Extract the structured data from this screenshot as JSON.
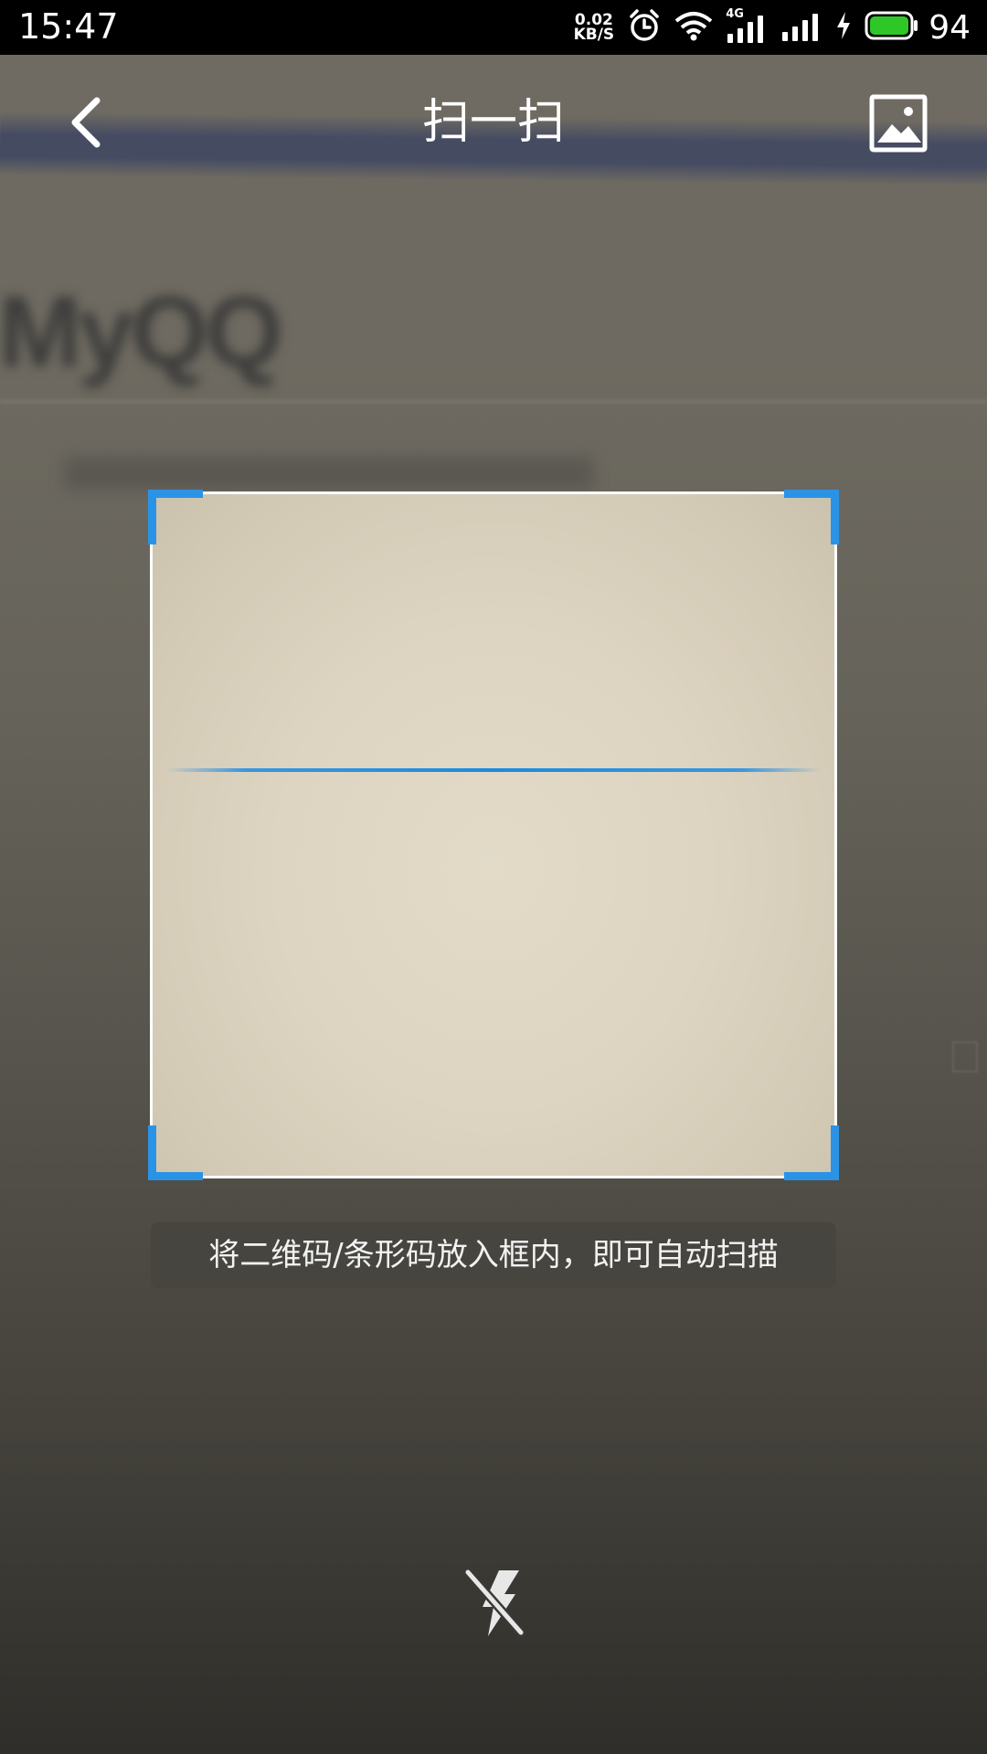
{
  "status_bar": {
    "time": "15:47",
    "net_speed_value": "0.02",
    "net_speed_unit": "KB/S",
    "network_type": "4G",
    "battery_percent": "94",
    "battery_color": "#2ec727",
    "icons": [
      "alarm-icon",
      "wifi-icon",
      "signal-4g-icon",
      "signal-icon",
      "charging-icon",
      "battery-icon"
    ]
  },
  "app_bar": {
    "title": "扫一扫",
    "back_icon": "chevron-left-icon",
    "album_icon": "image-album-icon"
  },
  "background": {
    "blurred_text": "MyQQ"
  },
  "scanner": {
    "accent_color": "#2a93e6",
    "hint": "将二维码/条形码放入框内，即可自动扫描",
    "flash_icon": "flash-off-icon"
  }
}
